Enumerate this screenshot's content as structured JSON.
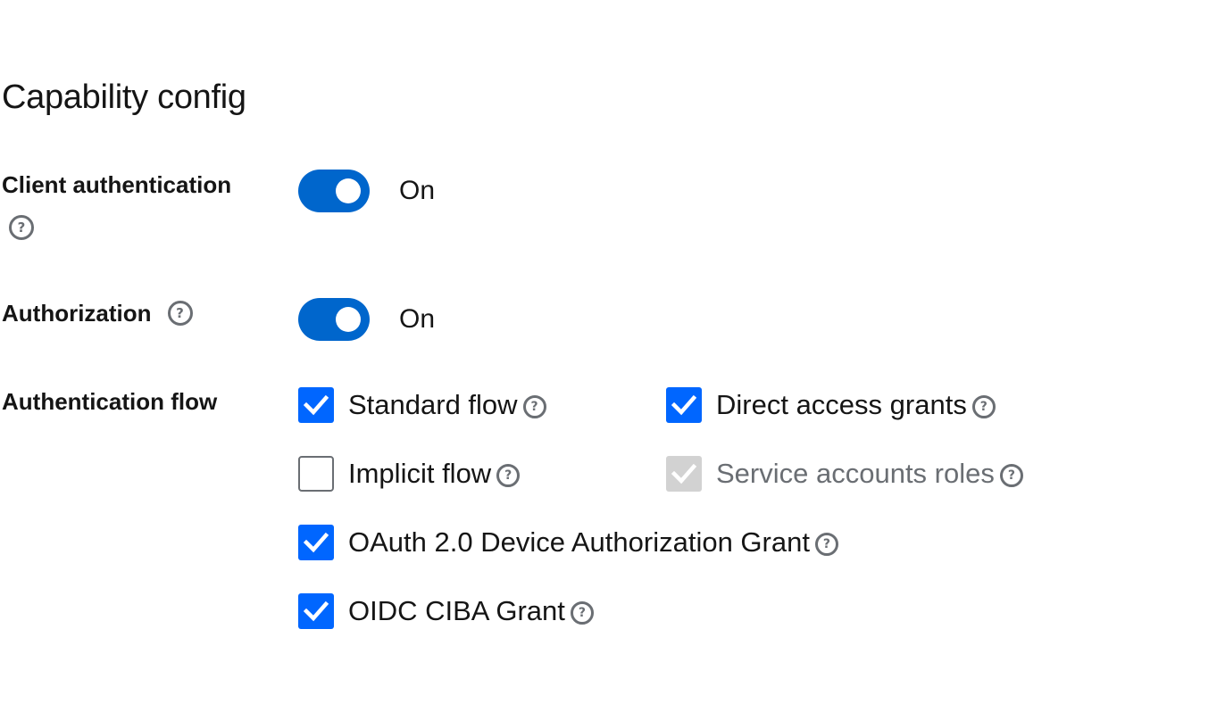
{
  "title": "Capability config",
  "client_authentication": {
    "label": "Client authentication",
    "state_label": "On"
  },
  "authorization": {
    "label": "Authorization",
    "state_label": "On"
  },
  "authentication_flow": {
    "label": "Authentication flow",
    "options": [
      {
        "label": "Standard flow",
        "checked": true
      },
      {
        "label": "Direct access grants",
        "checked": true
      },
      {
        "label": "Implicit flow",
        "checked": false
      },
      {
        "label": "Service accounts roles",
        "checked": true,
        "disabled": true
      },
      {
        "label": "OAuth 2.0 Device Authorization Grant",
        "checked": true
      },
      {
        "label": "OIDC CIBA Grant",
        "checked": true
      }
    ]
  },
  "help_glyph": "?",
  "colors": {
    "accent": "#0066cc",
    "checkbox": "#0066ff",
    "disabled": "#d2d2d2",
    "muted": "#6a6e73"
  }
}
